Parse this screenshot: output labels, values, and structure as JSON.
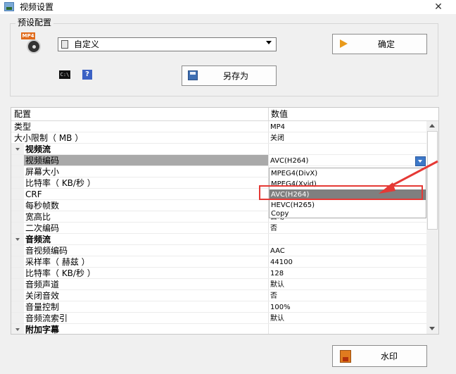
{
  "window": {
    "title": "视频设置",
    "close_label": "✕"
  },
  "preset": {
    "group_label": "预设配置",
    "icon_tag": "MP4",
    "selected": "自定义",
    "ok_label": "确定",
    "save_as_label": "另存为",
    "cmd_icon_text": "C:\\",
    "help_icon_text": "?"
  },
  "grid": {
    "header_name": "配置",
    "header_value": "数值",
    "rows": [
      {
        "name": "类型",
        "value": "MP4"
      },
      {
        "name": "大小限制（ MB ）",
        "value": "关闭"
      },
      {
        "name": "视频流",
        "value": ""
      },
      {
        "name": "视频编码",
        "value": "AVC(H264)"
      },
      {
        "name": "屏幕大小",
        "value": ""
      },
      {
        "name": "比特率（ KB/秒 ）",
        "value": ""
      },
      {
        "name": "CRF",
        "value": ""
      },
      {
        "name": "每秒帧数",
        "value": ""
      },
      {
        "name": "宽高比",
        "value": "自动"
      },
      {
        "name": "二次编码",
        "value": "否"
      },
      {
        "name": "音频流",
        "value": ""
      },
      {
        "name": "音视频编码",
        "value": "AAC"
      },
      {
        "name": "采样率（ 赫兹 ）",
        "value": "44100"
      },
      {
        "name": "比特率（ KB/秒 ）",
        "value": "128"
      },
      {
        "name": "音频声道",
        "value": "默认"
      },
      {
        "name": "关闭音效",
        "value": "否"
      },
      {
        "name": "音量控制",
        "value": "100%"
      },
      {
        "name": "音频流索引",
        "value": "默认"
      },
      {
        "name": "附加字幕",
        "value": ""
      }
    ],
    "dropdown_options": [
      "MPEG4(DivX)",
      "MPEG4(Xvid)",
      "AVC(H264)",
      "HEVC(H265)",
      "Copy"
    ],
    "dropdown_selected": "AVC(H264)"
  },
  "footer": {
    "watermark_label": "水印"
  },
  "colors": {
    "annotation": "#e53935",
    "selection": "#a9a9a9",
    "highlight": "#7f7f7f"
  }
}
